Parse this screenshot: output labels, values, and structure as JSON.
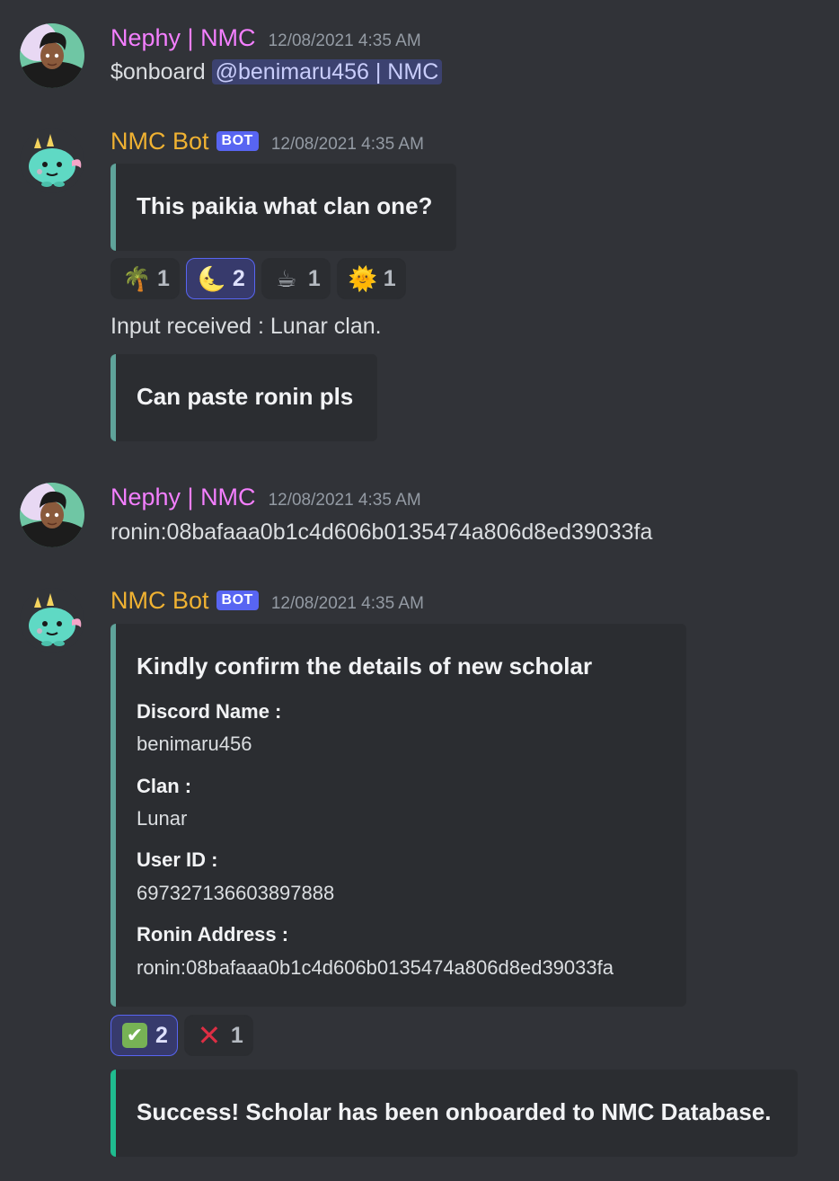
{
  "messages": [
    {
      "author": "Nephy | NMC",
      "timestamp": "12/08/2021 4:35 AM",
      "text_prefix": "$onboard ",
      "mention": "@benimaru456 | NMC"
    },
    {
      "author": "NMC Bot",
      "bot_tag": "BOT",
      "timestamp": "12/08/2021 4:35 AM",
      "embed1_title": "This paikia what clan one?",
      "reactions": [
        {
          "emoji": "🌴",
          "icon": "palm-tree-icon",
          "count": "1",
          "active": false
        },
        {
          "emoji": "🌜",
          "icon": "crescent-moon-icon",
          "count": "2",
          "active": true
        },
        {
          "emoji": "☕",
          "icon": "coffee-icon",
          "count": "1",
          "active": false
        },
        {
          "emoji": "🌞",
          "icon": "sun-icon",
          "count": "1",
          "active": false
        }
      ],
      "input_text": "Input received : Lunar clan.",
      "embed2_title": "Can paste ronin pls"
    },
    {
      "author": "Nephy | NMC",
      "timestamp": "12/08/2021 4:35 AM",
      "text": "ronin:08bafaaa0b1c4d606b0135474a806d8ed39033fa"
    },
    {
      "author": "NMC Bot",
      "bot_tag": "BOT",
      "timestamp": "12/08/2021 4:35 AM",
      "embed_title": "Kindly confirm the details of new scholar",
      "fields": [
        {
          "name": "Discord Name :",
          "value": "benimaru456"
        },
        {
          "name": "Clan :",
          "value": "Lunar"
        },
        {
          "name": "User ID :",
          "value": "697327136603897888"
        },
        {
          "name": "Ronin Address :",
          "value": "ronin:08bafaaa0b1c4d606b0135474a806d8ed39033fa"
        }
      ],
      "reactions": [
        {
          "emoji": "✔",
          "icon": "check-mark-icon",
          "count": "2",
          "active": true
        },
        {
          "emoji": "✕",
          "icon": "cross-mark-icon",
          "count": "1",
          "active": false
        }
      ],
      "success_text": "Success! Scholar has been onboarded to NMC Database."
    }
  ]
}
